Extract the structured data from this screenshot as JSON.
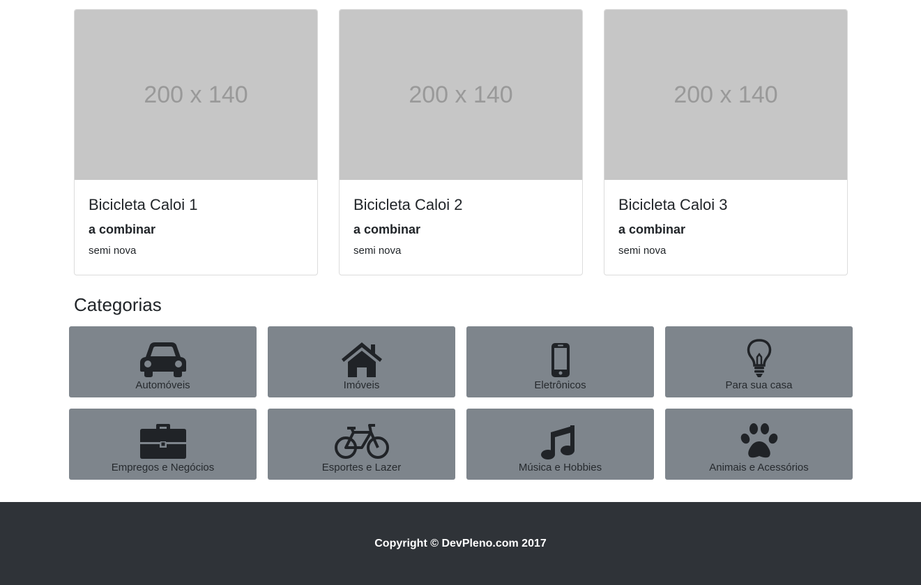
{
  "listings": [
    {
      "image_placeholder": "200 x 140",
      "title": "Bicicleta Caloi 1",
      "price": "a combinar",
      "description": "semi nova"
    },
    {
      "image_placeholder": "200 x 140",
      "title": "Bicicleta Caloi 2",
      "price": "a combinar",
      "description": "semi nova"
    },
    {
      "image_placeholder": "200 x 140",
      "title": "Bicicleta Caloi 3",
      "price": "a combinar",
      "description": "semi nova"
    }
  ],
  "categories": {
    "heading": "Categorias",
    "items": [
      {
        "label": "Automóveis",
        "icon": "car-icon"
      },
      {
        "label": "Imóveis",
        "icon": "home-icon"
      },
      {
        "label": "Eletrônicos",
        "icon": "mobile-phone-icon"
      },
      {
        "label": "Para sua casa",
        "icon": "lightbulb-icon"
      },
      {
        "label": "Empregos e Negócios",
        "icon": "briefcase-icon"
      },
      {
        "label": "Esportes e Lazer",
        "icon": "bicycle-icon"
      },
      {
        "label": "Música e Hobbies",
        "icon": "music-note-icon"
      },
      {
        "label": "Animais e Acessórios",
        "icon": "paw-icon"
      }
    ]
  },
  "footer": {
    "copyright": "Copyright © DevPleno.com 2017"
  },
  "colors": {
    "tile": "#7e858c",
    "footer": "#2f3338",
    "placeholder": "#c6c6c6"
  }
}
